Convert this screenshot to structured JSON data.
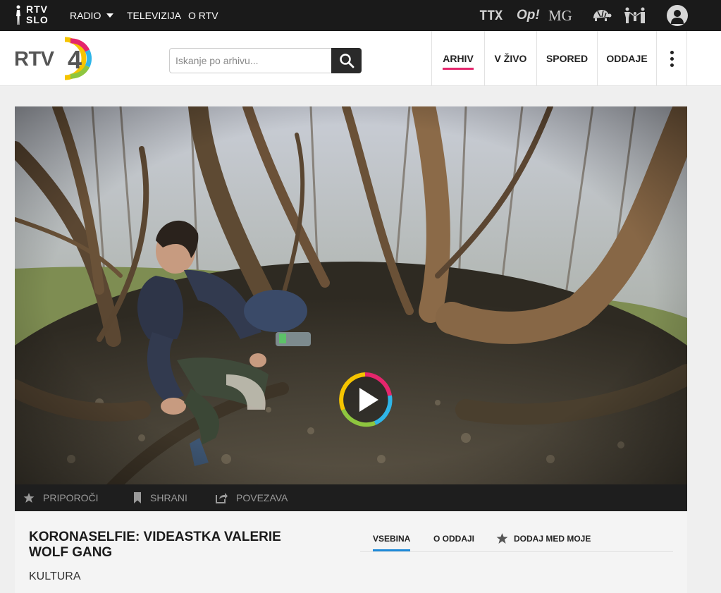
{
  "topbar": {
    "logo_line1": "RTV",
    "logo_line2": "SLO",
    "nav": {
      "radio": "RADIO",
      "tv": "TELEVIZIJA",
      "ortv": "O RTV"
    },
    "brands": {
      "ttx": "TTX",
      "op": "Op!",
      "mg": "MG"
    },
    "icons": [
      "turtle-icon",
      "family-icon",
      "user-icon"
    ]
  },
  "header": {
    "logo_text": "RTV",
    "logo_number": "4",
    "search": {
      "placeholder": "Iskanje po arhivu..."
    },
    "nav": {
      "arhiv": "ARHIV",
      "vzivo": "V ŽIVO",
      "spored": "SPORED",
      "oddaje": "ODDAJE"
    },
    "active": "ARHIV"
  },
  "video": {
    "actions": {
      "recommend": "PRIPOROČI",
      "save": "SHRANI",
      "link": "POVEZAVA"
    }
  },
  "show": {
    "title": "KORONASELFIE: VIDEASTKA VALERIE WOLF GANG",
    "genre": "KULTURA",
    "tabs": {
      "content": "VSEBINA",
      "about": "O ODDAJI",
      "add": "DODAJ MED MOJE"
    }
  },
  "colors": {
    "accent_pink": "#e4266c",
    "accent_blue": "#1f8ad8",
    "topbar": "#1a1a1a"
  }
}
